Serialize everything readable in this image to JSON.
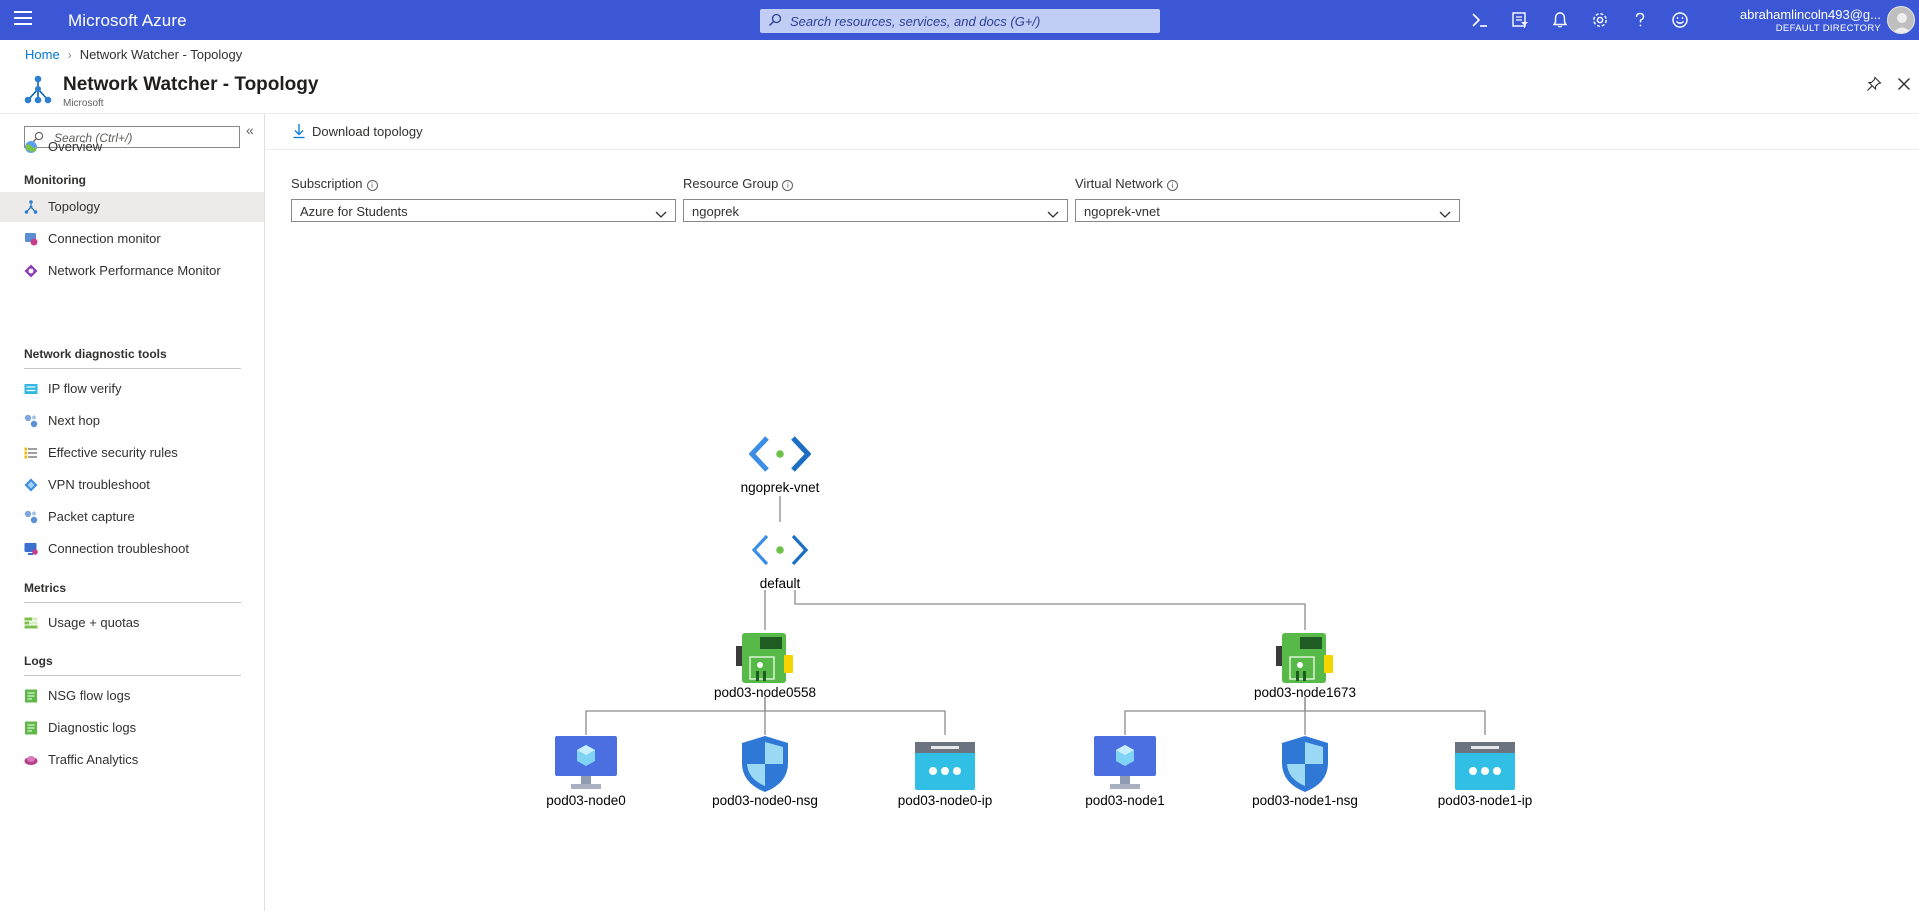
{
  "topbar": {
    "brand": "Microsoft Azure",
    "search_placeholder": "Search resources, services, and docs (G+/)",
    "icons": [
      "cloud-shell-icon",
      "directory-filter-icon",
      "notifications-icon",
      "settings-icon",
      "help-icon",
      "feedback-icon"
    ],
    "user_email": "abrahamlincoln493@g...",
    "user_directory": "DEFAULT DIRECTORY"
  },
  "breadcrumb": {
    "home": "Home",
    "current": "Network Watcher - Topology"
  },
  "blade": {
    "title": "Network Watcher - Topology",
    "subtitle": "Microsoft"
  },
  "sidebar": {
    "search_placeholder": "Search (Ctrl+/)",
    "overview": "Overview",
    "sections": [
      {
        "title": "Monitoring",
        "items": [
          "Topology",
          "Connection monitor",
          "Network Performance Monitor"
        ]
      },
      {
        "title": "Network diagnostic tools",
        "items": [
          "IP flow verify",
          "Next hop",
          "Effective security rules",
          "VPN troubleshoot",
          "Packet capture",
          "Connection troubleshoot"
        ]
      },
      {
        "title": "Metrics",
        "items": [
          "Usage + quotas"
        ]
      },
      {
        "title": "Logs",
        "items": [
          "NSG flow logs",
          "Diagnostic logs",
          "Traffic Analytics"
        ]
      }
    ],
    "selected": "Topology"
  },
  "toolbar": {
    "download_label": "Download topology"
  },
  "filters": {
    "subscription": {
      "label": "Subscription",
      "value": "Azure for Students"
    },
    "resource_group": {
      "label": "Resource Group",
      "value": "ngoprek"
    },
    "virtual_network": {
      "label": "Virtual Network",
      "value": "ngoprek-vnet"
    }
  },
  "topology": {
    "vnet": "ngoprek-vnet",
    "subnet": "default",
    "nics": [
      {
        "name": "pod03-node0558",
        "vm": "pod03-node0",
        "nsg": "pod03-node0-nsg",
        "ip": "pod03-node0-ip"
      },
      {
        "name": "pod03-node1673",
        "vm": "pod03-node1",
        "nsg": "pod03-node1-nsg",
        "ip": "pod03-node1-ip"
      }
    ]
  },
  "colors": {
    "topbar": "#3b57d6",
    "link": "#0078d4",
    "vm_blue": "#4b6ee0",
    "nic_green": "#57b947",
    "ip_cyan": "#32bfe6",
    "shield_blue": "#2f78d6"
  }
}
